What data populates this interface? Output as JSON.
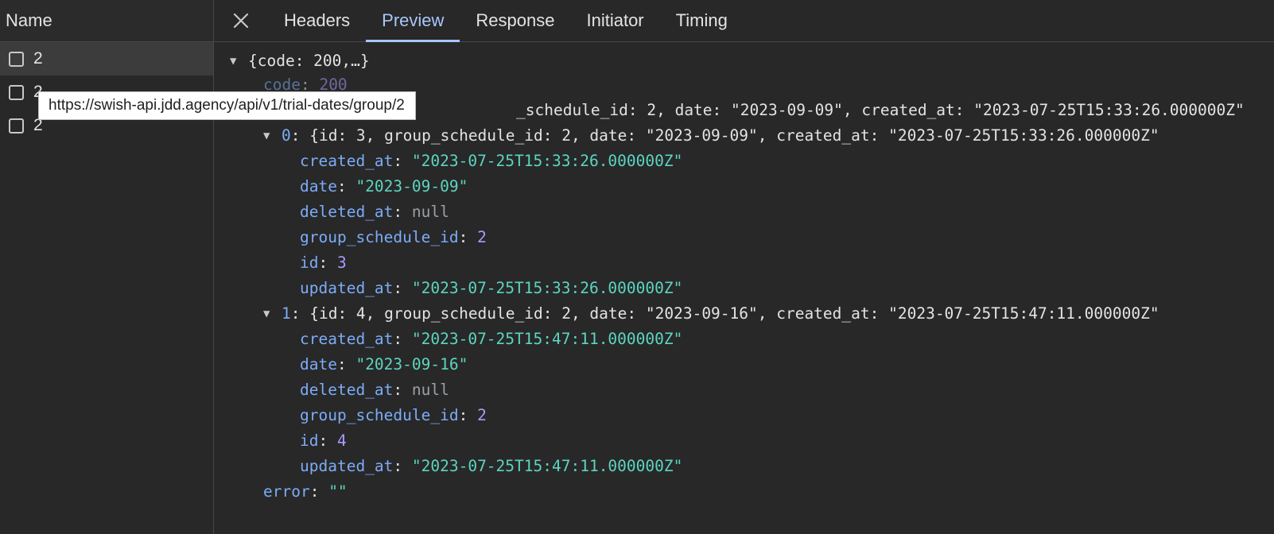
{
  "left_panel": {
    "header": "Name",
    "requests": [
      {
        "label": "2"
      },
      {
        "label": "2"
      },
      {
        "label": "2"
      }
    ]
  },
  "tooltip": {
    "url": "https://swish-api.jdd.agency/api/v1/trial-dates/group/2"
  },
  "tabs": {
    "close_icon": "close-icon",
    "items": [
      "Headers",
      "Preview",
      "Response",
      "Initiator",
      "Timing"
    ],
    "active": "Preview"
  },
  "preview": {
    "root_summary": "{code: 200,…}",
    "code_key": "code",
    "code_value": "200",
    "data_summary_visible": "{id: 3, group_schedule_id: 2, date: \"2023-09-09\", created_at: \"2023-07-25T15:33:26.000000Z\"",
    "data_summary_fragment": "_schedule_id: 2, date: \"2023-09-09\", created_at: \"2023-07-25T15:33:26.000000Z\"",
    "items": [
      {
        "index": "0",
        "summary": "{id: 3, group_schedule_id: 2, date: \"2023-09-09\", created_at: \"2023-07-25T15:33:26.000000Z\"",
        "created_at": "\"2023-07-25T15:33:26.000000Z\"",
        "date": "\"2023-09-09\"",
        "deleted_at": "null",
        "group_schedule_id": "2",
        "id": "3",
        "updated_at": "\"2023-07-25T15:33:26.000000Z\""
      },
      {
        "index": "1",
        "summary": "{id: 4, group_schedule_id: 2, date: \"2023-09-16\", created_at: \"2023-07-25T15:47:11.000000Z\"",
        "created_at": "\"2023-07-25T15:47:11.000000Z\"",
        "date": "\"2023-09-16\"",
        "deleted_at": "null",
        "group_schedule_id": "2",
        "id": "4",
        "updated_at": "\"2023-07-25T15:47:11.000000Z\""
      }
    ],
    "labels": {
      "created_at": "created_at",
      "date": "date",
      "deleted_at": "deleted_at",
      "group_schedule_id": "group_schedule_id",
      "id": "id",
      "updated_at": "updated_at",
      "error": "error"
    },
    "error_value": "\"\""
  },
  "colors": {
    "accent": "#a8c7fa",
    "key": "#7cacf8",
    "string": "#5cd5c0",
    "number": "#a99cff",
    "null": "#9aa0a6",
    "background": "#282828"
  }
}
